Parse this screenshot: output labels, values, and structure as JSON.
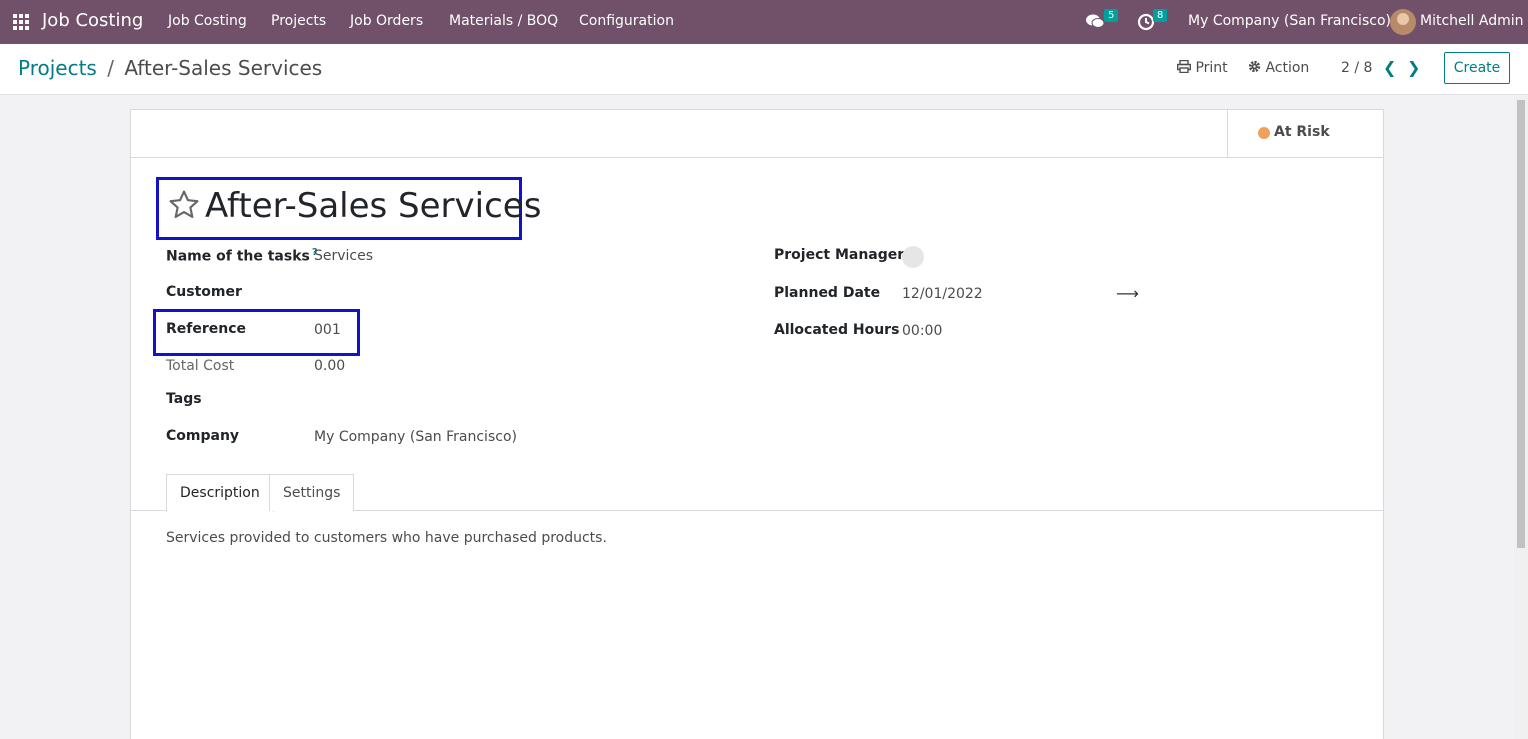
{
  "topnav": {
    "app_name": "Job Costing",
    "menu": [
      "Job Costing",
      "Projects",
      "Job Orders",
      "Materials / BOQ",
      "Configuration"
    ],
    "messages_count": "5",
    "activities_count": "8",
    "company": "My Company (San Francisco)",
    "user": "Mitchell Admin"
  },
  "control_panel": {
    "breadcrumb_parent": "Projects",
    "breadcrumb_separator": "/",
    "breadcrumb_current": "After-Sales Services",
    "print_label": "Print",
    "action_label": "Action",
    "pager": "2 / 8",
    "create_label": "Create"
  },
  "status": {
    "label": "At Risk",
    "color": "#f0a05a"
  },
  "record": {
    "title": "After-Sales Services",
    "fields_left": {
      "name_of_tasks_label": "Name of the tasks",
      "name_of_tasks_help": "?",
      "name_of_tasks_value": "Services",
      "customer_label": "Customer",
      "reference_label": "Reference",
      "reference_value": "001",
      "total_cost_label": "Total Cost",
      "total_cost_value": "0.00",
      "tags_label": "Tags",
      "company_label": "Company",
      "company_value": "My Company (San Francisco)"
    },
    "fields_right": {
      "project_manager_label": "Project Manager",
      "planned_date_label": "Planned Date",
      "planned_date_value": "12/01/2022",
      "allocated_hours_label": "Allocated Hours",
      "allocated_hours_value": "00:00"
    }
  },
  "tabs": [
    "Description",
    "Settings"
  ],
  "description_text": "Services provided to customers who have purchased products."
}
